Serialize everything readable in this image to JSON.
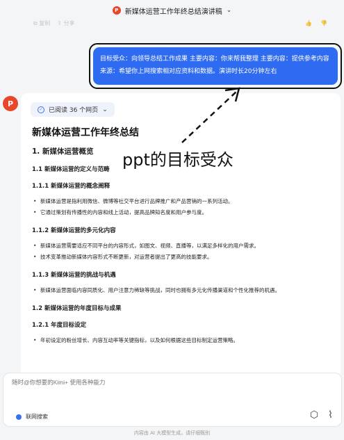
{
  "header": {
    "title": "新媒体运营工作年终总结演讲稿",
    "icon": "ppt-icon"
  },
  "actions": {
    "copy_label": "复制",
    "share_label": "分享"
  },
  "user_message": "目标受众：向领导总结工作成果 主要内容：你来帮我整理 主要内容：提供参考内容来源：希望你上网搜索相对应资料和数据。演讲时长20分钟左右",
  "assistant": {
    "avatar_letter": "P",
    "read_chip": "已阅读 36 个网页",
    "doc_title": "新媒体运营工作年终总结",
    "sections": {
      "h1_overview": "1. 新媒体运营概览",
      "h2_definition": "1.1 新媒体运营的定义与范畴",
      "h3_concept": "1.1.1 新媒体运营的概念阐释",
      "concept_items": [
        "新媒体运营是指利用微信、微博等社交平台进行品牌推广和产品营销的一系列活动。",
        "它通过策划有传播性的内容和线上活动，提高品牌知名度和用户参与度。"
      ],
      "h3_diversity": "1.1.2 新媒体运营的多元化内容",
      "diversity_items": [
        "新媒体运营需要适应不同平台的内容形式，如图文、视频、直播等，以满足多样化的用户需求。",
        "技术变革推动新媒体内容形式不断更新，对运营者提出了更高的技能要求。"
      ],
      "h3_challenge": "1.1.3 新媒体运营的挑战与机遇",
      "challenge_items": [
        "新媒体运营面临内容同质化、用户注意力稀缺等挑战，同时也拥有多元化传播渠道和个性化推荐的机遇。"
      ],
      "h2_goals": "1.2 新媒体运营的年度目标与成果",
      "h3_annual": "1.2.1 年度目标设定",
      "annual_items": [
        "年初设定的粉丝增长、内容互动率等关键指标，以及如何根据这些目标制定运营策略。"
      ]
    }
  },
  "annotation": "ppt的目标受众",
  "input": {
    "placeholder": "随时@你想要的Kimi+ 使用各种能力",
    "web_search_label": "联网搜索"
  },
  "footer_note": "内容由 AI 大模型生成，请仔细甄别",
  "colors": {
    "accent": "#2f6bf0",
    "ppt": "#e8472c"
  }
}
